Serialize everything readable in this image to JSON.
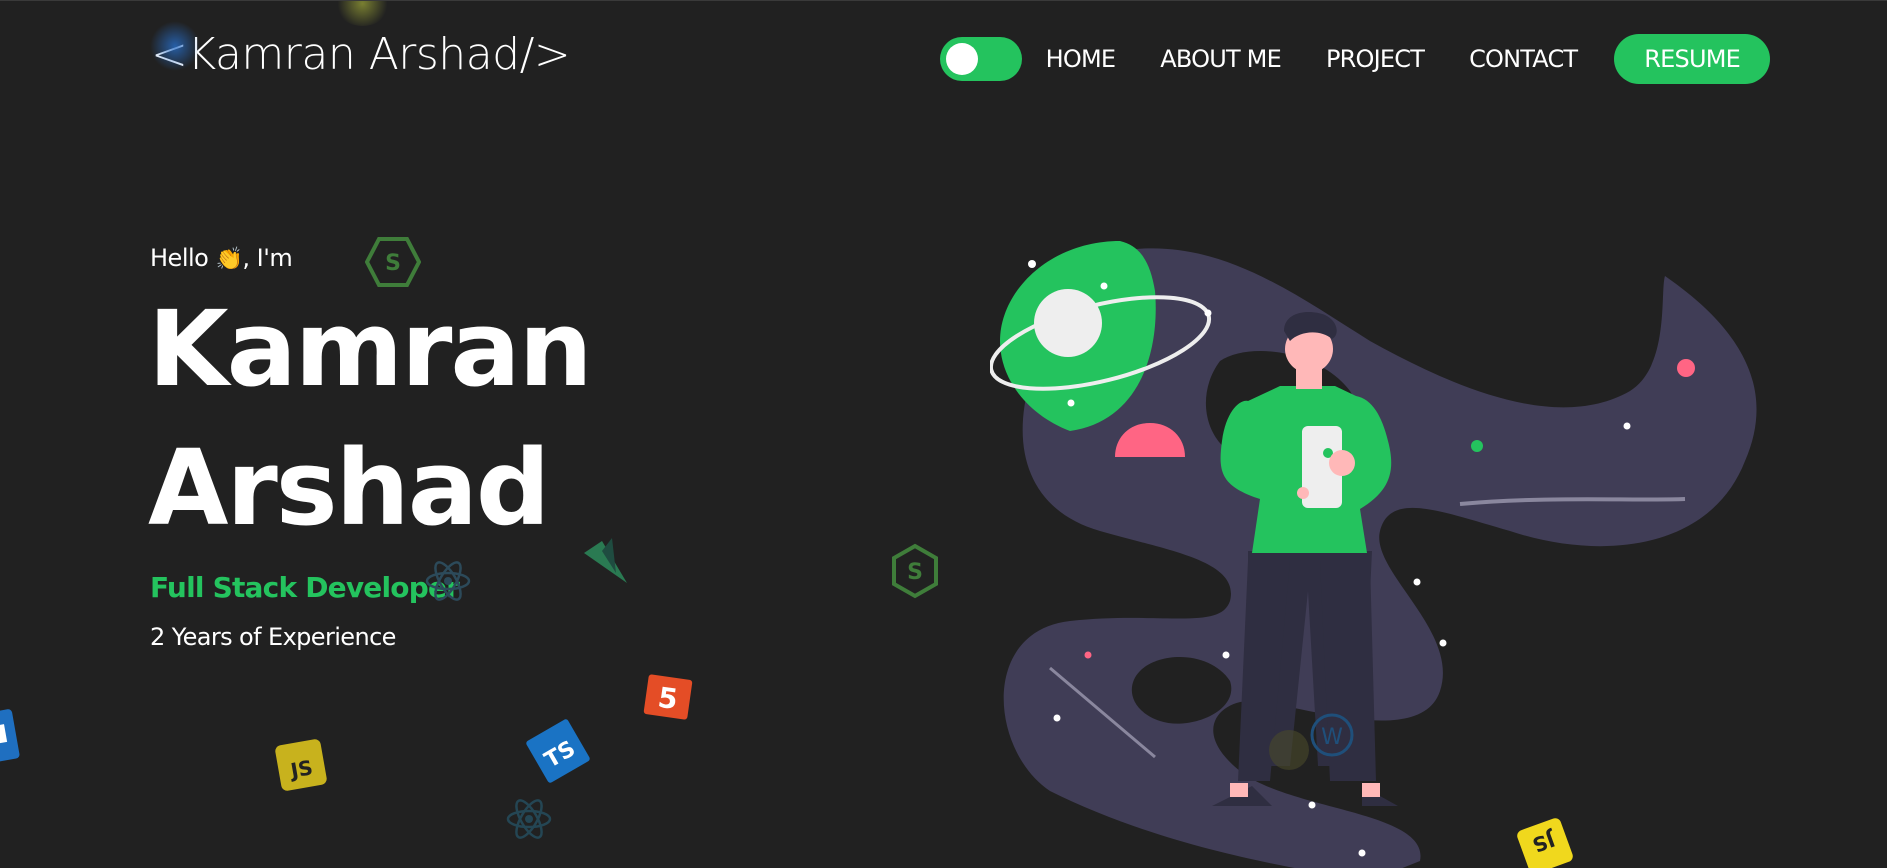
{
  "logo": {
    "text": "<Kamran Arshad/>"
  },
  "nav": {
    "items": [
      {
        "label": "HOME"
      },
      {
        "label": "ABOUT ME"
      },
      {
        "label": "PROJECT"
      },
      {
        "label": "CONTACT"
      }
    ],
    "resume_label": "RESUME",
    "theme_toggle": {
      "state": "on"
    }
  },
  "hero": {
    "greeting_prefix": "Hello",
    "greeting_emoji": "👏",
    "greeting_suffix": ", I'm",
    "first_name": "Kamran",
    "last_name": "Arshad",
    "role": "Full Stack Developer",
    "experience": "2 Years of Experience"
  },
  "floating_icons": [
    {
      "name": "nodejs-icon",
      "label": ""
    },
    {
      "name": "vue-icon",
      "label": ""
    },
    {
      "name": "react-icon",
      "label": ""
    },
    {
      "name": "html5-icon",
      "label": "5"
    },
    {
      "name": "typescript-icon",
      "label": "TS"
    },
    {
      "name": "javascript-icon",
      "label": "JS"
    },
    {
      "name": "wordpress-icon",
      "label": ""
    }
  ],
  "colors": {
    "background": "#212121",
    "accent": "#24c35e",
    "text": "#ffffff",
    "illustration_band": "#403d56",
    "pink": "#ff6584"
  }
}
